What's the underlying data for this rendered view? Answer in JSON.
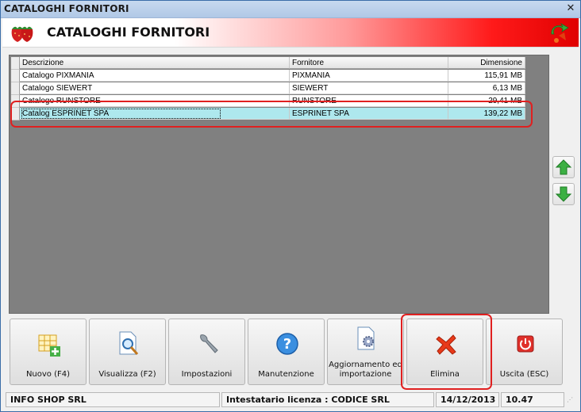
{
  "window": {
    "title": "CATALOGHI FORNITORI",
    "close_glyph": "✕"
  },
  "header": {
    "title": "CATALOGHI FORNITORI"
  },
  "table": {
    "columns": [
      "Descrizione",
      "Fornitore",
      "Dimensione"
    ],
    "rows": [
      {
        "descrizione": "Catalogo PIXMANIA",
        "fornitore": "PIXMANIA",
        "dimensione": "115,91 MB"
      },
      {
        "descrizione": "Catalogo SIEWERT",
        "fornitore": "SIEWERT",
        "dimensione": "6,13 MB"
      },
      {
        "descrizione": "Catalogo RUNSTORE",
        "fornitore": "RUNSTORE",
        "dimensione": "29,41 MB"
      },
      {
        "descrizione": "Catalog ESPRINET SPA",
        "fornitore": "ESPRINET SPA",
        "dimensione": "139,22 MB"
      }
    ],
    "selected_row": 3
  },
  "side_buttons": {
    "up_icon": "arrow-up-icon",
    "down_icon": "arrow-down-icon"
  },
  "toolbar": {
    "nuovo": "Nuovo (F4)",
    "visualizza": "Visualizza (F2)",
    "impostazioni": "Impostazioni",
    "manutenzione": "Manutenzione",
    "aggiornamento_1": "Aggiornamento ed",
    "aggiornamento_2": "importazione",
    "elimina": "Elimina",
    "uscita": "Uscita (ESC)"
  },
  "statusbar": {
    "company": "INFO SHOP SRL",
    "license": "Intestatario licenza : CODICE SRL",
    "date": "14/12/2013",
    "time": "10.47"
  },
  "colors": {
    "accent_red": "#e02020",
    "selection": "#aee8ee",
    "grid_bg": "#808080"
  }
}
